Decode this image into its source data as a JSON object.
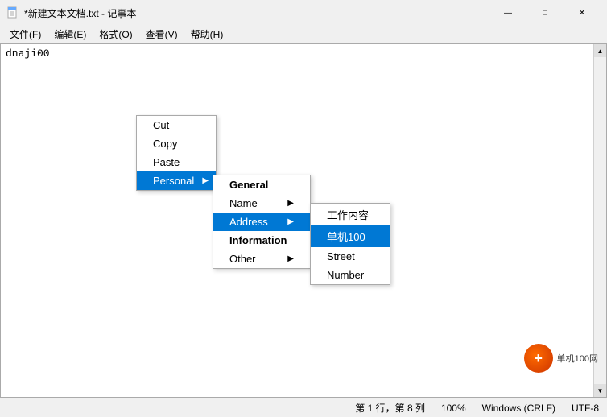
{
  "titleBar": {
    "icon": "📄",
    "title": "*新建文本文档.txt - 记事本",
    "minimize": "—",
    "maximize": "□",
    "close": "✕"
  },
  "menuBar": {
    "items": [
      {
        "label": "文件(F)"
      },
      {
        "label": "编辑(E)"
      },
      {
        "label": "格式(O)"
      },
      {
        "label": "查看(V)"
      },
      {
        "label": "帮助(H)"
      }
    ]
  },
  "editor": {
    "content": "dnaji00"
  },
  "contextMenu1": {
    "items": [
      {
        "label": "Cut",
        "hasSubmenu": false
      },
      {
        "label": "Copy",
        "hasSubmenu": false
      },
      {
        "label": "Paste",
        "hasSubmenu": false
      },
      {
        "label": "Personal",
        "hasSubmenu": true,
        "highlighted": true
      }
    ]
  },
  "contextMenu2": {
    "items": [
      {
        "label": "General",
        "hasSubmenu": false,
        "bold": true,
        "highlighted": false
      },
      {
        "label": "Name",
        "hasSubmenu": true
      },
      {
        "label": "Address",
        "hasSubmenu": true,
        "highlighted": true
      },
      {
        "label": "Information",
        "hasSubmenu": false,
        "bold": true
      },
      {
        "label": "Other",
        "hasSubmenu": true
      }
    ]
  },
  "contextMenu3": {
    "items": [
      {
        "label": "工作内容",
        "highlighted": false
      },
      {
        "label": "单机100",
        "highlighted": true
      },
      {
        "label": "Street",
        "highlighted": false
      },
      {
        "label": "Number",
        "highlighted": false
      }
    ]
  },
  "statusBar": {
    "position": "第 1 行，第 8 列",
    "zoom": "100%",
    "lineEnding": "Windows (CRLF)",
    "encoding": "UTF-8"
  },
  "watermark": {
    "text": "单机100网"
  }
}
